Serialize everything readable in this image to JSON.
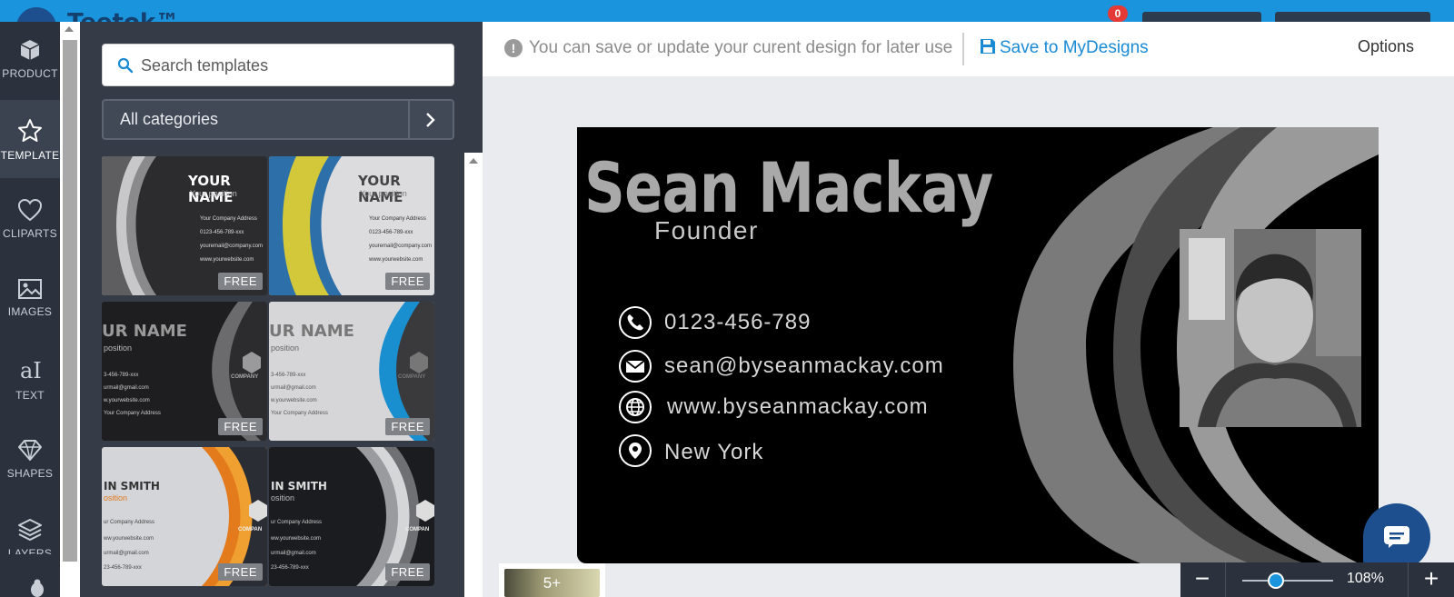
{
  "app": {
    "logo_text": "Teetok™",
    "notification_count": "0"
  },
  "leftnav": {
    "items": [
      {
        "label": "PRODUCT",
        "icon": "cube-icon"
      },
      {
        "label": "TEMPLATE",
        "icon": "star-icon"
      },
      {
        "label": "CLIPARTS",
        "icon": "heart-icon"
      },
      {
        "label": "IMAGES",
        "icon": "image-icon"
      },
      {
        "label": "TEXT",
        "icon": "text-icon"
      },
      {
        "label": "SHAPES",
        "icon": "diamond-icon"
      },
      {
        "label": "LAYERS",
        "icon": "layers-icon"
      }
    ],
    "active": "TEMPLATE"
  },
  "panel": {
    "search_placeholder": "Search templates",
    "category_label": "All categories",
    "templates": [
      {
        "name": "YOUR NAME",
        "position": "Your position",
        "lines": [
          "Your Company Address",
          "0123-456-789-xxx",
          "youremail@company.com",
          "www.yourwebsite.com"
        ],
        "badge": "FREE"
      },
      {
        "name": "YOUR NAME",
        "position": "Your position",
        "lines": [
          "Your Company Address",
          "0123-456-789-xxx",
          "youremail@company.com",
          "www.yourwebsite.com"
        ],
        "badge": "FREE"
      },
      {
        "name": "UR NAME",
        "position": "position",
        "lines": [
          "3-456-789-xxx",
          "urmail@gmail.com",
          "w.yourwebsite.com",
          "Your Company Address"
        ],
        "company": "COMPANY",
        "badge": "FREE"
      },
      {
        "name": "UR NAME",
        "position": "position",
        "lines": [
          "3-456-789-xxx",
          "urmail@gmail.com",
          "w.yourwebsite.com",
          "Your Company Address"
        ],
        "company": "COMPANY",
        "badge": "FREE"
      },
      {
        "name": "IN SMITH",
        "position": "osition",
        "lines": [
          "ur Company Address",
          "ww.yourwebsite.com",
          "urmail@gmail.com",
          "23-456-789-xxx"
        ],
        "company": "COMPAN",
        "badge": "FREE"
      },
      {
        "name": "IN SMITH",
        "position": "osition",
        "lines": [
          "ur Company Address",
          "ww.yourwebsite.com",
          "urmail@gmail.com",
          "23-456-789-xxx"
        ],
        "company": "COMPAN",
        "badge": "FREE"
      }
    ]
  },
  "infobar": {
    "message": "You can save or update your curent design for later use",
    "save_label": "Save to MyDesigns",
    "options_label": "Options"
  },
  "card": {
    "name": "Sean Mackay",
    "title": "Founder",
    "contacts": [
      {
        "icon": "phone-icon",
        "text": "0123-456-789"
      },
      {
        "icon": "envelope-icon",
        "text": "sean@byseanmackay.com"
      },
      {
        "icon": "globe-icon",
        "text": "www.byseanmackay.com"
      },
      {
        "icon": "location-pin-icon",
        "text": "New York"
      }
    ]
  },
  "pages": {
    "thumb_label": "5+"
  },
  "zoom": {
    "minus": "−",
    "plus": "+",
    "value_label": "108%",
    "level": 1.08
  },
  "colors": {
    "accent": "#1a95dd",
    "nav_bg": "#2b323d",
    "panel_bg": "#353c48",
    "save_link": "#1a8ad5"
  }
}
